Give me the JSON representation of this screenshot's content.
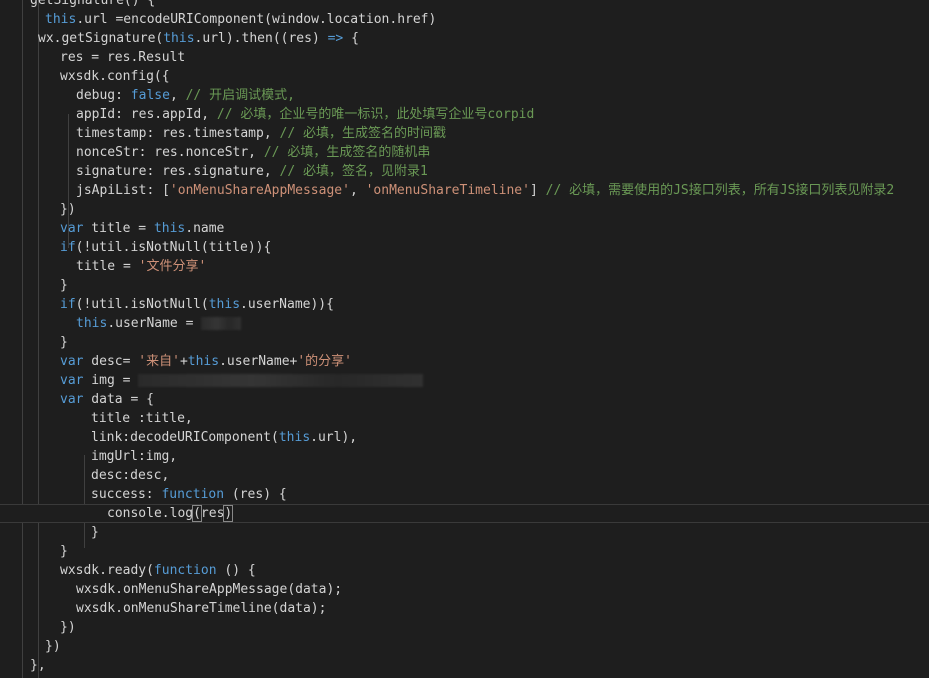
{
  "editor": {
    "lines": [
      [
        {
          "t": "getSignature() {",
          "c": "pl"
        }
      ],
      [
        {
          "t": "this",
          "c": "kw"
        },
        {
          "t": ".url =encodeURIComponent(window.location.href)",
          "c": "pl"
        }
      ],
      [
        {
          "t": "wx.getSignature(",
          "c": "pl"
        },
        {
          "t": "this",
          "c": "kw"
        },
        {
          "t": ".url).then((res) ",
          "c": "pl"
        },
        {
          "t": "=>",
          "c": "kw"
        },
        {
          "t": " {",
          "c": "pl"
        }
      ],
      [
        {
          "t": "res = res.Result",
          "c": "pl"
        }
      ],
      [
        {
          "t": "wxsdk.config({",
          "c": "pl"
        }
      ],
      [
        {
          "t": "debug: ",
          "c": "pl"
        },
        {
          "t": "false",
          "c": "kw"
        },
        {
          "t": ", ",
          "c": "pl"
        },
        {
          "t": "// 开启调试模式,",
          "c": "cmt"
        }
      ],
      [
        {
          "t": "appId: res.appId, ",
          "c": "pl"
        },
        {
          "t": "// 必填，企业号的唯一标识，此处填写企业号corpid",
          "c": "cmt"
        }
      ],
      [
        {
          "t": "timestamp: res.timestamp, ",
          "c": "pl"
        },
        {
          "t": "// 必填，生成签名的时间戳",
          "c": "cmt"
        }
      ],
      [
        {
          "t": "nonceStr: res.nonceStr, ",
          "c": "pl"
        },
        {
          "t": "// 必填，生成签名的随机串",
          "c": "cmt"
        }
      ],
      [
        {
          "t": "signature: res.signature, ",
          "c": "pl"
        },
        {
          "t": "// 必填，签名，见附录1",
          "c": "cmt"
        }
      ],
      [
        {
          "t": "jsApiList: [",
          "c": "pl"
        },
        {
          "t": "'onMenuShareAppMessage'",
          "c": "str"
        },
        {
          "t": ", ",
          "c": "pl"
        },
        {
          "t": "'onMenuShareTimeline'",
          "c": "str"
        },
        {
          "t": "] ",
          "c": "pl"
        },
        {
          "t": "// 必填，需要使用的JS接口列表，所有JS接口列表见附录2",
          "c": "cmt"
        }
      ],
      [
        {
          "t": "})",
          "c": "pl"
        }
      ],
      [
        {
          "t": "var",
          "c": "kw"
        },
        {
          "t": " title = ",
          "c": "pl"
        },
        {
          "t": "this",
          "c": "kw"
        },
        {
          "t": ".name",
          "c": "pl"
        }
      ],
      [
        {
          "t": "if",
          "c": "kw"
        },
        {
          "t": "(!util.isNotNull(title)){",
          "c": "pl"
        }
      ],
      [
        {
          "t": "title = ",
          "c": "pl"
        },
        {
          "t": "'文件分享'",
          "c": "str"
        }
      ],
      [
        {
          "t": "}",
          "c": "pl"
        }
      ],
      [
        {
          "t": "if",
          "c": "kw"
        },
        {
          "t": "(!util.isNotNull(",
          "c": "pl"
        },
        {
          "t": "this",
          "c": "kw"
        },
        {
          "t": ".userName)){",
          "c": "pl"
        }
      ],
      [
        {
          "t": "this",
          "c": "kw"
        },
        {
          "t": ".userName = ",
          "c": "pl"
        },
        {
          "blur": 40
        }
      ],
      [
        {
          "t": "}",
          "c": "pl"
        }
      ],
      [
        {
          "t": "var",
          "c": "kw"
        },
        {
          "t": " desc= ",
          "c": "pl"
        },
        {
          "t": "'来自'",
          "c": "str"
        },
        {
          "t": "+",
          "c": "pl"
        },
        {
          "t": "this",
          "c": "kw"
        },
        {
          "t": ".userName+",
          "c": "pl"
        },
        {
          "t": "'的分享'",
          "c": "str"
        }
      ],
      [
        {
          "t": "var",
          "c": "kw"
        },
        {
          "t": " img = ",
          "c": "pl"
        },
        {
          "blur": 285
        }
      ],
      [
        {
          "t": "var",
          "c": "kw"
        },
        {
          "t": " data = {",
          "c": "pl"
        }
      ],
      [
        {
          "t": "title :title,",
          "c": "pl"
        }
      ],
      [
        {
          "t": "link:decodeURIComponent(",
          "c": "pl"
        },
        {
          "t": "this",
          "c": "kw"
        },
        {
          "t": ".url),",
          "c": "pl"
        }
      ],
      [
        {
          "t": "imgUrl:img,",
          "c": "pl"
        }
      ],
      [
        {
          "t": "desc:desc,",
          "c": "pl"
        }
      ],
      [
        {
          "t": "success: ",
          "c": "pl"
        },
        {
          "t": "function",
          "c": "kw"
        },
        {
          "t": " (res) {",
          "c": "pl"
        }
      ],
      [
        {
          "t": "console.log",
          "c": "pl"
        },
        {
          "t": "(",
          "c": "pl",
          "m": 1
        },
        {
          "t": "res",
          "c": "pl"
        },
        {
          "t": ")",
          "c": "pl",
          "m": 1
        }
      ],
      [
        {
          "t": "}",
          "c": "pl"
        }
      ],
      [
        {
          "t": "}",
          "c": "pl"
        }
      ],
      [
        {
          "t": "wxsdk.ready(",
          "c": "pl"
        },
        {
          "t": "function",
          "c": "kw"
        },
        {
          "t": " () {",
          "c": "pl"
        }
      ],
      [
        {
          "t": "wxsdk.onMenuShareAppMessage(data);",
          "c": "pl"
        }
      ],
      [
        {
          "t": "wxsdk.onMenuShareTimeline(data);",
          "c": "pl"
        }
      ],
      [
        {
          "t": "})",
          "c": "pl"
        }
      ],
      [
        {
          "t": "})",
          "c": "pl"
        }
      ],
      [
        {
          "t": "},",
          "c": "pl"
        }
      ]
    ]
  }
}
